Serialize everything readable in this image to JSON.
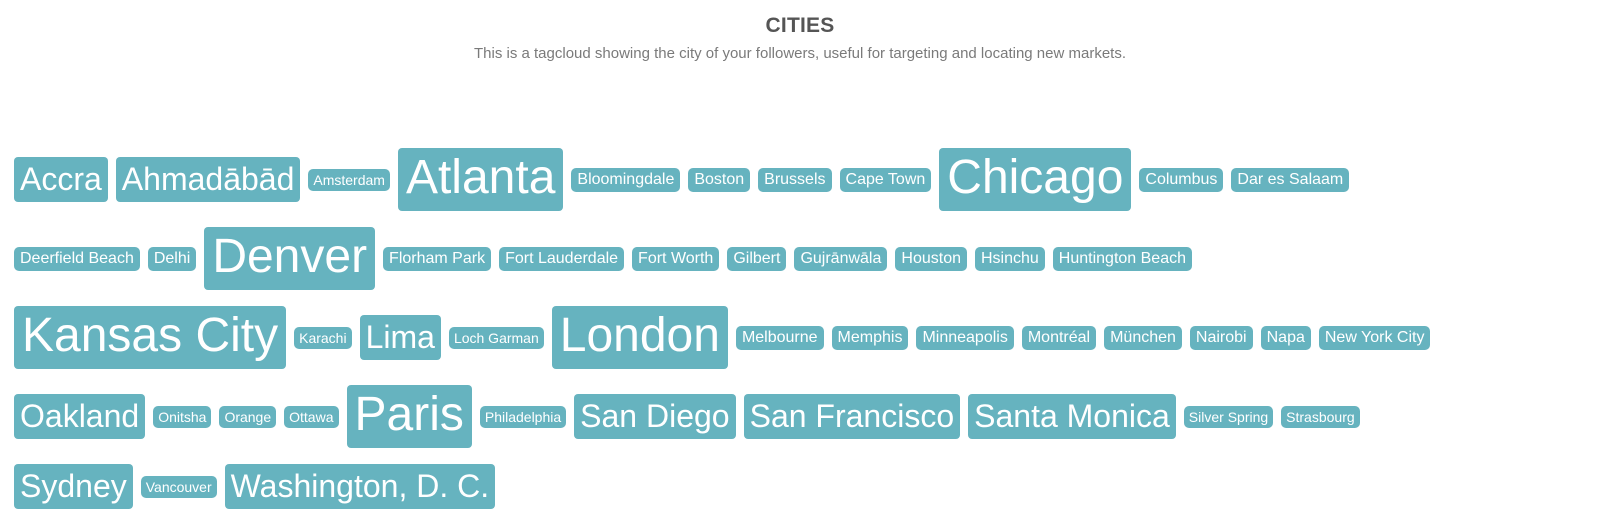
{
  "header": {
    "title": "CITIES",
    "subtitle": "This is a tagcloud showing the city of your followers, useful for targeting and locating new markets."
  },
  "colors": {
    "tag_background": "#66b3bf",
    "tag_text": "#ffffff",
    "title": "#555555",
    "subtitle": "#7a7a7a"
  },
  "size_levels": {
    "1": "smallest",
    "2": "small",
    "3": "medium",
    "4": "large"
  },
  "tags": [
    {
      "label": "Accra",
      "level": 3
    },
    {
      "label": "Ahmadābād",
      "level": 3
    },
    {
      "label": "Amsterdam",
      "level": 1
    },
    {
      "label": "Atlanta",
      "level": 4
    },
    {
      "label": "Bloomingdale",
      "level": 2
    },
    {
      "label": "Boston",
      "level": 2
    },
    {
      "label": "Brussels",
      "level": 2
    },
    {
      "label": "Cape Town",
      "level": 2
    },
    {
      "label": "Chicago",
      "level": 4
    },
    {
      "label": "Columbus",
      "level": 2
    },
    {
      "label": "Dar es Salaam",
      "level": 2
    },
    {
      "label": "Deerfield Beach",
      "level": 2
    },
    {
      "label": "Delhi",
      "level": 2
    },
    {
      "label": "Denver",
      "level": 4
    },
    {
      "label": "Florham Park",
      "level": 2
    },
    {
      "label": "Fort Lauderdale",
      "level": 2
    },
    {
      "label": "Fort Worth",
      "level": 2
    },
    {
      "label": "Gilbert",
      "level": 2
    },
    {
      "label": "Gujrānwāla",
      "level": 2
    },
    {
      "label": "Houston",
      "level": 2
    },
    {
      "label": "Hsinchu",
      "level": 2
    },
    {
      "label": "Huntington Beach",
      "level": 2
    },
    {
      "label": "Kansas City",
      "level": 4
    },
    {
      "label": "Karachi",
      "level": 1
    },
    {
      "label": "Lima",
      "level": 3
    },
    {
      "label": "Loch Garman",
      "level": 1
    },
    {
      "label": "London",
      "level": 4
    },
    {
      "label": "Melbourne",
      "level": 2
    },
    {
      "label": "Memphis",
      "level": 2
    },
    {
      "label": "Minneapolis",
      "level": 2
    },
    {
      "label": "Montréal",
      "level": 2
    },
    {
      "label": "München",
      "level": 2
    },
    {
      "label": "Nairobi",
      "level": 2
    },
    {
      "label": "Napa",
      "level": 2
    },
    {
      "label": "New York City",
      "level": 2
    },
    {
      "label": "Oakland",
      "level": 3
    },
    {
      "label": "Onitsha",
      "level": 1
    },
    {
      "label": "Orange",
      "level": 1
    },
    {
      "label": "Ottawa",
      "level": 1
    },
    {
      "label": "Paris",
      "level": 4
    },
    {
      "label": "Philadelphia",
      "level": 1
    },
    {
      "label": "San Diego",
      "level": 3
    },
    {
      "label": "San Francisco",
      "level": 3
    },
    {
      "label": "Santa Monica",
      "level": 3
    },
    {
      "label": "Silver Spring",
      "level": 1
    },
    {
      "label": "Strasbourg",
      "level": 1
    },
    {
      "label": "Sydney",
      "level": 3
    },
    {
      "label": "Vancouver",
      "level": 1
    },
    {
      "label": "Washington, D. C.",
      "level": 3
    }
  ]
}
